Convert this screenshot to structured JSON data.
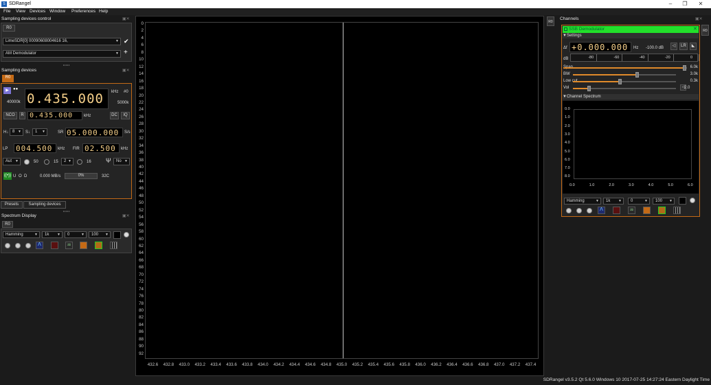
{
  "window": {
    "title": "SDRangel",
    "logo": "S"
  },
  "menu": [
    "File",
    "View",
    "Devices",
    "Window",
    "Preferences",
    "Help"
  ],
  "left": {
    "sdc_title": "Sampling devices control",
    "sdc_tab": "R0",
    "device_combo": "LimeSDR[0] 00090608004616 16,",
    "demod_combo": "AM Demodulator",
    "sd_title": "Sampling devices",
    "sd_tab": "R0",
    "freq_unit": "kHz",
    "dev_index": "#0",
    "freq": "0.435.000",
    "rate_left": "40000k",
    "rate_right": "5000k",
    "nco_label": "NCO",
    "r_label": "R",
    "nco_freq": "0.435.000",
    "nco_unit": "kHz",
    "dc_label": "DC",
    "iq_label": "IQ",
    "h_label": "H↓",
    "h_val": "8",
    "s_label": "S↓",
    "s_val": "1",
    "sr_label": "SR",
    "sr_val": "05.000.000",
    "sr_unit": "S/s",
    "lp_label": "LP",
    "lp_val": "004.500",
    "lp_unit": "kHz",
    "fir_label": "FIR",
    "fir_val": "02.500",
    "fir_unit": "kHz",
    "gain_mode": "Aut",
    "gain1": "50",
    "gain2": "15",
    "gain3_combo": "2",
    "gain4": "16",
    "antenna": "No",
    "u_label": "U",
    "o_label": "O",
    "d_label": "D",
    "rate": "0.000 MB/s",
    "buffer": "0%",
    "temp": "32C",
    "tabs": [
      "Presets",
      "Sampling devices"
    ],
    "sp_title": "Spectrum Display",
    "sp_tab": "R0",
    "window_fn": "Hamming",
    "fft_size": "1k",
    "ref": "0",
    "range": "100"
  },
  "spectrum": {
    "y_labels": [
      "0",
      "2",
      "4",
      "6",
      "8",
      "10",
      "12",
      "14",
      "16",
      "18",
      "20",
      "22",
      "24",
      "26",
      "28",
      "30",
      "32",
      "34",
      "36",
      "38",
      "40",
      "42",
      "44",
      "46",
      "48",
      "50",
      "52",
      "54",
      "56",
      "58",
      "60",
      "62",
      "64",
      "66",
      "68",
      "70",
      "72",
      "74",
      "76",
      "78",
      "80",
      "82",
      "84",
      "86",
      "88",
      "90",
      "92"
    ],
    "x_labels": [
      "432.6",
      "432.8",
      "433.0",
      "433.2",
      "433.4",
      "433.6",
      "433.8",
      "434.0",
      "434.2",
      "434.4",
      "434.6",
      "434.8",
      "435.0",
      "435.2",
      "435.4",
      "435.6",
      "435.8",
      "436.0",
      "436.2",
      "436.4",
      "436.6",
      "436.8",
      "437.0",
      "437.2",
      "437.4"
    ],
    "center_marker": 0.5
  },
  "rtab": "R0",
  "channels": {
    "title": "Channels",
    "side_tab": "R0",
    "demod_title": "SSB Demodulator",
    "settings": "▼Settings",
    "df_label": "Δf",
    "df_val": "+0.000.000",
    "hz": "Hz",
    "db_val": "-100.0 dB",
    "lr_label": "LR",
    "db_label": "dB",
    "db_scale": [
      "-80",
      "-60",
      "-40",
      "-20",
      "0"
    ],
    "sliders": [
      {
        "label": "Span",
        "value": "6.0k",
        "fraction": 0.98
      },
      {
        "label": "BW",
        "value": "3.0k",
        "fraction": 0.62
      },
      {
        "label": "Low cut",
        "value": "0.3k",
        "fraction": 0.45
      },
      {
        "label": "Vol",
        "value": "2.0",
        "fraction": 0.15
      }
    ],
    "cs_title": "▼Channel Spectrum",
    "cs_y": [
      "0.0",
      "1.0",
      "2.0",
      "3.0",
      "4.0",
      "5.0",
      "6.0",
      "7.0",
      "8.0"
    ],
    "cs_x": [
      "0.0",
      "1.0",
      "2.0",
      "3.0",
      "4.0",
      "5.0",
      "6.0"
    ],
    "window_fn": "Hamming",
    "fft_size": "1k",
    "ref": "0",
    "range": "100"
  },
  "status": "SDRangel v3.5.2 Qt 5.6.0 Windows 10  2017-07-25 14:27:24 Eastern Daylight Time",
  "colors": {
    "accent": "#c46a16",
    "green": "#22e02a",
    "lcd": "#f6d08a"
  }
}
